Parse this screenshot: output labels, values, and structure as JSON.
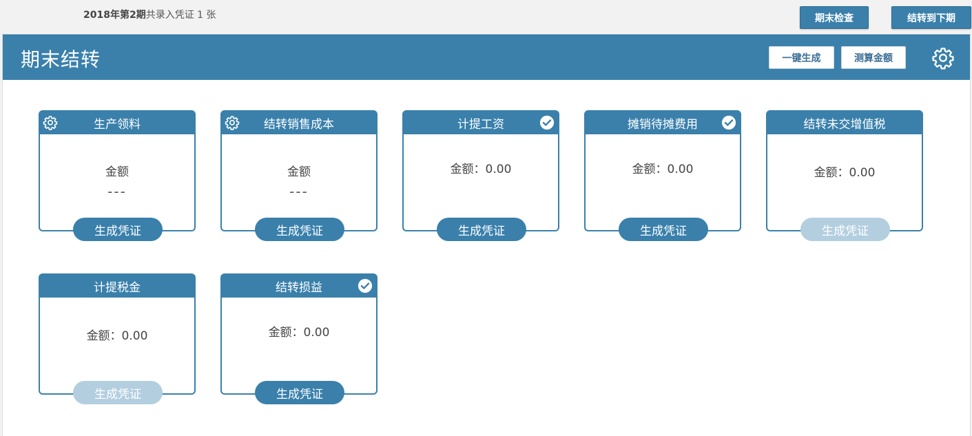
{
  "top": {
    "period_bold": "2018年第2期",
    "period_text": "共录入凭证 1 张",
    "check_label": "期末检查",
    "next_label": "结转到下期"
  },
  "header": {
    "title": "期末结转",
    "gen_all_label": "一键生成",
    "calc_label": "测算金额",
    "settings_icon": "gear-icon"
  },
  "colors": {
    "primary": "#3a80ab",
    "disabled": "#b3cfdf"
  },
  "cards": [
    {
      "title": "生产领料",
      "amount_label": "金额",
      "amount": "---",
      "button": "生成凭证",
      "button_enabled": true,
      "has_gear": true,
      "checked": false
    },
    {
      "title": "结转销售成本",
      "amount_label": "金额",
      "amount": "---",
      "button": "生成凭证",
      "button_enabled": true,
      "has_gear": true,
      "checked": false
    },
    {
      "title": "计提工资",
      "amount_label": "金额：0.00",
      "button": "生成凭证",
      "button_enabled": true,
      "has_gear": false,
      "checked": true
    },
    {
      "title": "摊销待摊费用",
      "amount_label": "金额：0.00",
      "button": "生成凭证",
      "button_enabled": true,
      "has_gear": false,
      "checked": true
    },
    {
      "title": "结转未交增值税",
      "amount_label": "金额：0.00",
      "button": "生成凭证",
      "button_enabled": false,
      "has_gear": false,
      "checked": false
    },
    {
      "title": "计提税金",
      "amount_label": "金额：0.00",
      "button": "生成凭证",
      "button_enabled": false,
      "has_gear": false,
      "checked": false
    },
    {
      "title": "结转损益",
      "amount_label": "金额：0.00",
      "button": "生成凭证",
      "button_enabled": true,
      "has_gear": false,
      "checked": true
    }
  ]
}
